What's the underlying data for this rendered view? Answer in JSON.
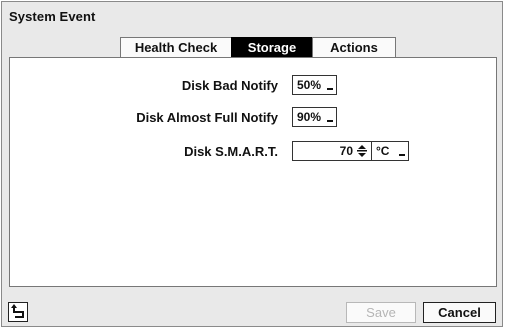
{
  "window": {
    "title": "System Event"
  },
  "tabs": [
    {
      "label": "Health Check",
      "selected": false
    },
    {
      "label": "Storage",
      "selected": true
    },
    {
      "label": "Actions",
      "selected": false
    }
  ],
  "storage": {
    "disk_bad_notify": {
      "label": "Disk Bad Notify",
      "value": "50%"
    },
    "disk_almost_full_notify": {
      "label": "Disk Almost Full Notify",
      "value": "90%"
    },
    "disk_smart": {
      "label": "Disk S.M.A.R.T.",
      "value": "70",
      "unit": "°C"
    }
  },
  "footer": {
    "back_icon": "return-arrow-icon",
    "save_label": "Save",
    "save_enabled": false,
    "cancel_label": "Cancel"
  }
}
